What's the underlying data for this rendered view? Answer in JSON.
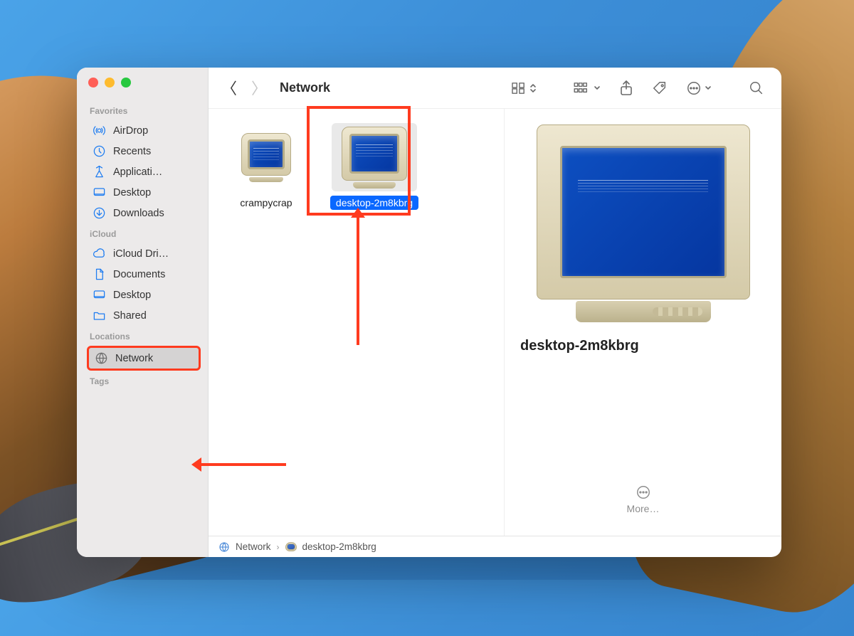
{
  "window_title": "Network",
  "sidebar": {
    "sections": {
      "favorites": {
        "label": "Favorites",
        "items": [
          {
            "icon": "airdrop",
            "label": "AirDrop"
          },
          {
            "icon": "clock",
            "label": "Recents"
          },
          {
            "icon": "apps",
            "label": "Applicati…"
          },
          {
            "icon": "desktop",
            "label": "Desktop"
          },
          {
            "icon": "download",
            "label": "Downloads"
          }
        ]
      },
      "icloud": {
        "label": "iCloud",
        "items": [
          {
            "icon": "cloud",
            "label": "iCloud Dri…"
          },
          {
            "icon": "doc",
            "label": "Documents"
          },
          {
            "icon": "desktop",
            "label": "Desktop"
          },
          {
            "icon": "folder",
            "label": "Shared"
          }
        ]
      },
      "locations": {
        "label": "Locations",
        "items": [
          {
            "icon": "globe",
            "label": "Network",
            "active": true
          }
        ]
      },
      "tags": {
        "label": "Tags",
        "items": []
      }
    }
  },
  "items": [
    {
      "name": "crampycrap",
      "selected": false
    },
    {
      "name": "desktop-2m8kbrg",
      "selected": true
    }
  ],
  "preview": {
    "name": "desktop-2m8kbrg",
    "more_label": "More…"
  },
  "pathbar": {
    "root": "Network",
    "leaf": "desktop-2m8kbrg"
  },
  "annotations": {
    "highlight_selected_item": true,
    "highlight_network_sidebar": true
  }
}
